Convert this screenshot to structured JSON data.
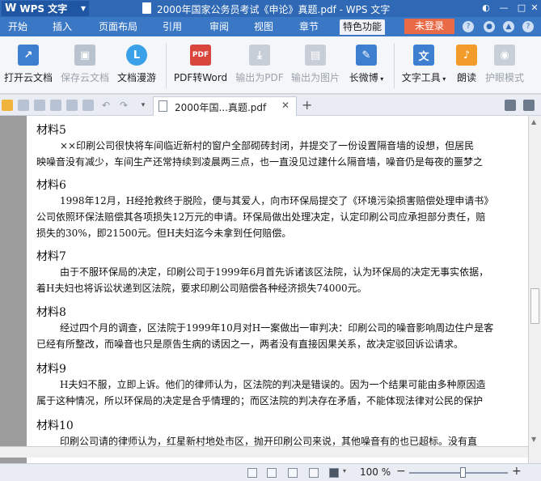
{
  "titlebar": {
    "app_menu": "WPS 文字",
    "title": "2000年国家公务员考试《申论》真题.pdf - WPS 文字"
  },
  "menu": {
    "tabs": [
      "开始",
      "插入",
      "页面布局",
      "引用",
      "审阅",
      "视图",
      "章节",
      "特色功能"
    ],
    "active_tab": "特色功能",
    "login": "未登录"
  },
  "ribbon": {
    "buttons": [
      "打开云文档",
      "保存云文档",
      "文档漫游",
      "PDF转Word",
      "输出为PDF",
      "输出为图片",
      "长微博",
      "文字工具",
      "朗读",
      "护眼模式"
    ]
  },
  "doctab": {
    "name": "2000年国...真题.pdf"
  },
  "document": {
    "materials": [
      {
        "heading": "材料5",
        "lines": [
          "××印刷公司很快将车间临近新村的窗户全部砌砖封闭，并提交了一份设置隔音墙的设想，但居民",
          "映噪音没有减少，车间生产还常持续到凌晨两三点，也一直没见过建什么隔音墙，噪音仍是每夜的噩梦之"
        ]
      },
      {
        "heading": "材料6",
        "lines": [
          "1998年12月，H经抢救终于脱险，便与其爱人，向市环保局提交了《环境污染损害赔偿处理申请书》",
          "公司依照环保法赔偿其各项损失12万元的申请。环保局做出处理决定，认定印刷公司应承担部分责任，赔",
          "损失的30%，即21500元。但H夫妇迄今未拿到任何赔偿。"
        ]
      },
      {
        "heading": "材料7",
        "lines": [
          "由于不服环保局的决定，印刷公司于1999年6月首先诉诸该区法院，认为环保局的决定无事实依据，",
          "着H夫妇也将诉讼状递到区法院，要求印刷公司赔偿各种经济损失74000元。"
        ]
      },
      {
        "heading": "材料8",
        "lines": [
          "经过四个月的调查，区法院于1999年10月对H一案做出一审判决：印刷公司的噪音影响周边住户是客",
          "已经有所整改，而噪音也只是原告生病的诱因之一，两者没有直接因果关系，故决定驳回诉讼请求。"
        ]
      },
      {
        "heading": "材料9",
        "lines": [
          "H夫妇不服，立即上诉。他们的律师认为，区法院的判决是错误的。因为一个结果可能由多种原因造",
          "属于这种情况，所以环保局的决定是合乎情理的；而区法院的判决存在矛盾，不能体现法律对公民的保护"
        ]
      },
      {
        "heading": "材料10",
        "lines": [
          "印刷公司请的律师认为，红星新村地处市区，抛开印刷公司来说，其他噪音有的也已超标。没有直"
        ]
      }
    ]
  },
  "statusbar": {
    "zoom": "100 %",
    "minus": "−",
    "plus": "+"
  },
  "colors": {
    "titlebar": "#2f69b5",
    "menubar": "#3a78c6",
    "login": "#e86a47"
  }
}
